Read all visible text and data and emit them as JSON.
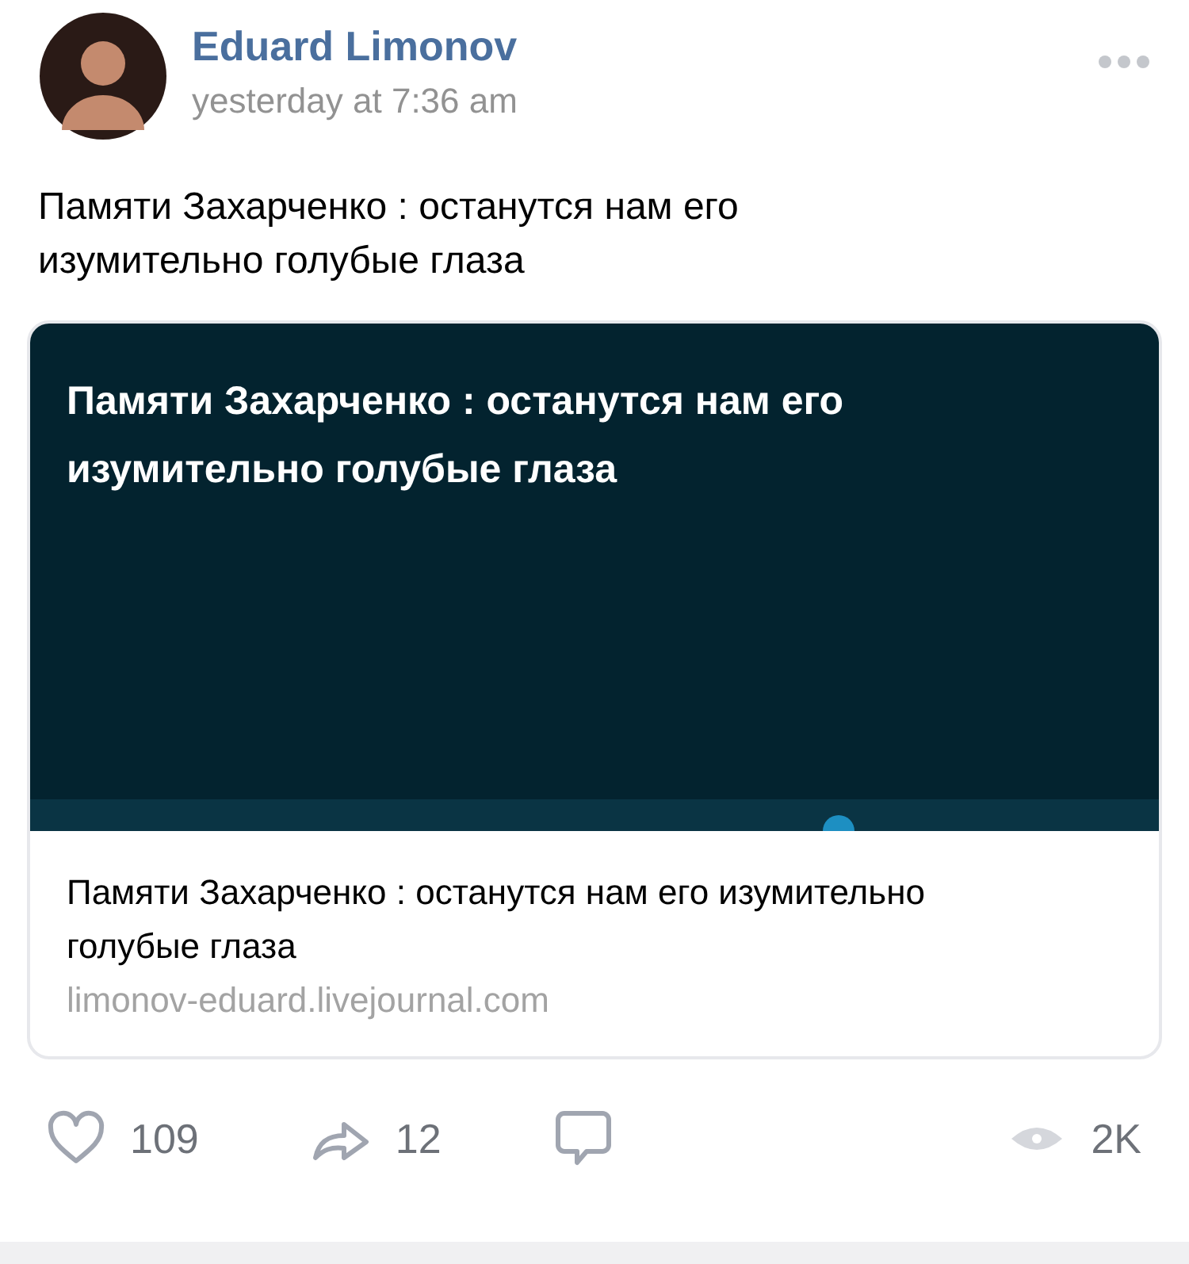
{
  "post": {
    "author": "Eduard Limonov",
    "time": "yesterday at 7:36 am",
    "text": "Памяти Захарченко : останутся нам его изумительно голубые глаза"
  },
  "link_card": {
    "image": {
      "kind": "banner",
      "headline": "Памяти Захарченко : останутся нам его изумительно голубые глаза"
    },
    "title": "Памяти Захарченко : останутся нам его изумительно голубые глаза",
    "domain": "limonov-eduard.livejournal.com"
  },
  "actions": [
    {
      "kind": "like",
      "count": "109"
    },
    {
      "kind": "share",
      "count": "12"
    },
    {
      "kind": "comment"
    },
    {
      "kind": "views",
      "count": "2K"
    }
  ]
}
